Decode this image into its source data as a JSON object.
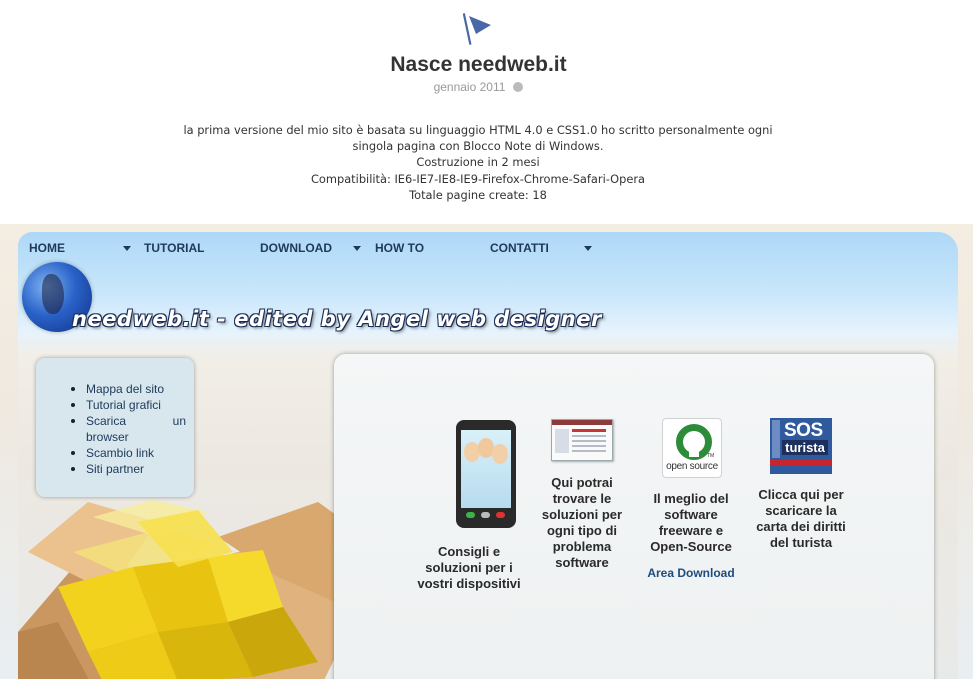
{
  "post": {
    "title": "Nasce needweb.it",
    "date": "gennaio 2011",
    "body_lines": [
      "la prima versione del mio sito è basata su linguaggio HTML 4.0 e CSS1.0 ho scritto personalmente ogni",
      "singola pagina con Blocco Note di Windows.",
      "Costruzione in 2 mesi",
      "Compatibilità: IE6-IE7-IE8-IE9-Firefox-Chrome-Safari-Opera",
      "Totale pagine create: 18"
    ]
  },
  "site": {
    "menu": [
      "HOME",
      "TUTORIAL",
      "DOWNLOAD",
      "HOW TO",
      "CONTATTI"
    ],
    "banner": "needweb.it - edited by Angel web designer",
    "sidebar": {
      "items": [
        "Mappa del sito",
        "Tutorial grafici",
        "Scarica",
        "un",
        "browser",
        "Scambio link",
        "Siti partner"
      ]
    },
    "cards": [
      {
        "label_lines": [
          "Consigli e",
          "soluzioni per i",
          "vostri dispositivi"
        ],
        "icon": "smartphone-icon"
      },
      {
        "label_lines": [
          "Qui potrai",
          "trovare le",
          "soluzioni per",
          "ogni tipo di",
          "problema",
          "software"
        ],
        "icon": "software-window-icon"
      },
      {
        "label_lines": [
          "Il meglio del",
          "software",
          "freeware e",
          "Open-Source"
        ],
        "link": "Area Download",
        "icon": "open-source-icon",
        "logo_text": "open source",
        "logo_tm": "TM"
      },
      {
        "label_lines": [
          "Clicca qui per",
          "scaricare la",
          "carta dei diritti",
          "del turista"
        ],
        "icon": "sos-turista-icon",
        "logo_text": "SOS",
        "logo_sub": "turista"
      }
    ]
  },
  "colors": {
    "menu_text": "#1e3a5a",
    "link": "#1e4c7e",
    "flag": "#4a68a8"
  }
}
